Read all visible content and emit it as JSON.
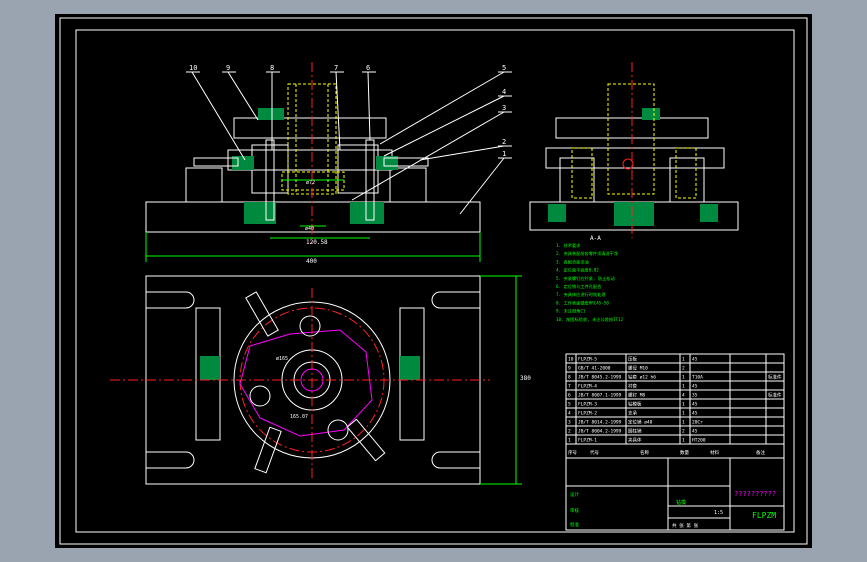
{
  "colors": {
    "background": "#9aa3b0",
    "paper": "#000000",
    "border": "#ffffff",
    "center_line": "#ff2020",
    "dimension": "#00ff00",
    "hidden": "#ffff00",
    "section_fill": "#00a050",
    "magenta": "#ff00ff",
    "text": "#ffffff"
  },
  "part_callouts": [
    "10",
    "9",
    "8",
    "7",
    "6",
    "5",
    "4",
    "3",
    "2",
    "1"
  ],
  "dimensions": {
    "inner_dia": "ø72",
    "bore": "ø40",
    "spacing": "120.58",
    "width": "400",
    "height": "380",
    "arc_a": "ø165",
    "arc_b": "165.07"
  },
  "section_label": "A-A",
  "notes": [
    "1. 技术要求",
    "2. 夹具装配前各零件须清洗干净",
    "3. 各配合面涂油",
    "4. 定位面平面度0.02",
    "5. 夹紧螺钉应拧紧, 防止松动",
    "6. 定位销与工件孔配合",
    "7. 夹具体应进行时效处理",
    "8. 工作表面硬度HRC45-50",
    "9. 未注倒角C1",
    "10. 按国标验收, 未注公差按IT12"
  ],
  "bom": [
    {
      "no": "10",
      "code": "FLPZM-5",
      "name": "压板",
      "qty": "1",
      "mat": "45",
      "note": ""
    },
    {
      "no": "9",
      "code": "GB/T 41-2000",
      "name": "螺母 M10",
      "qty": "2",
      "mat": "",
      "note": ""
    },
    {
      "no": "8",
      "code": "JB/T 8045.2-1999",
      "name": "钻套 ø12 h6",
      "qty": "1",
      "mat": "T10A",
      "note": "标准件"
    },
    {
      "no": "7",
      "code": "FLPZM-4",
      "name": "衬套",
      "qty": "1",
      "mat": "45",
      "note": ""
    },
    {
      "no": "6",
      "code": "JB/T 8007.1-1999",
      "name": "螺钉 M8",
      "qty": "4",
      "mat": "35",
      "note": "标准件"
    },
    {
      "no": "5",
      "code": "FLPZM-3",
      "name": "钻模板",
      "qty": "1",
      "mat": "45",
      "note": ""
    },
    {
      "no": "4",
      "code": "FLPZM-2",
      "name": "支承",
      "qty": "1",
      "mat": "45",
      "note": ""
    },
    {
      "no": "3",
      "code": "JB/T 8014.2-1999",
      "name": "定位销 ø40",
      "qty": "1",
      "mat": "20Cr",
      "note": ""
    },
    {
      "no": "2",
      "code": "JB/T 8004.2-1999",
      "name": "圆柱销",
      "qty": "2",
      "mat": "45",
      "note": ""
    },
    {
      "no": "1",
      "code": "FLPZM-1",
      "name": "夹具体",
      "qty": "1",
      "mat": "HT200",
      "note": ""
    }
  ],
  "bom_header": {
    "no": "序号",
    "code": "代号",
    "name": "名称",
    "qty": "数量",
    "mat": "材料",
    "note": "备注"
  },
  "title_block": {
    "title": "??????????",
    "drawing_no": "FLPZM",
    "scale": "1:5",
    "name_cell": "钻模",
    "designed": "设计",
    "checked": "审核",
    "approved": "批准",
    "sheet": "共 张 第 张"
  }
}
